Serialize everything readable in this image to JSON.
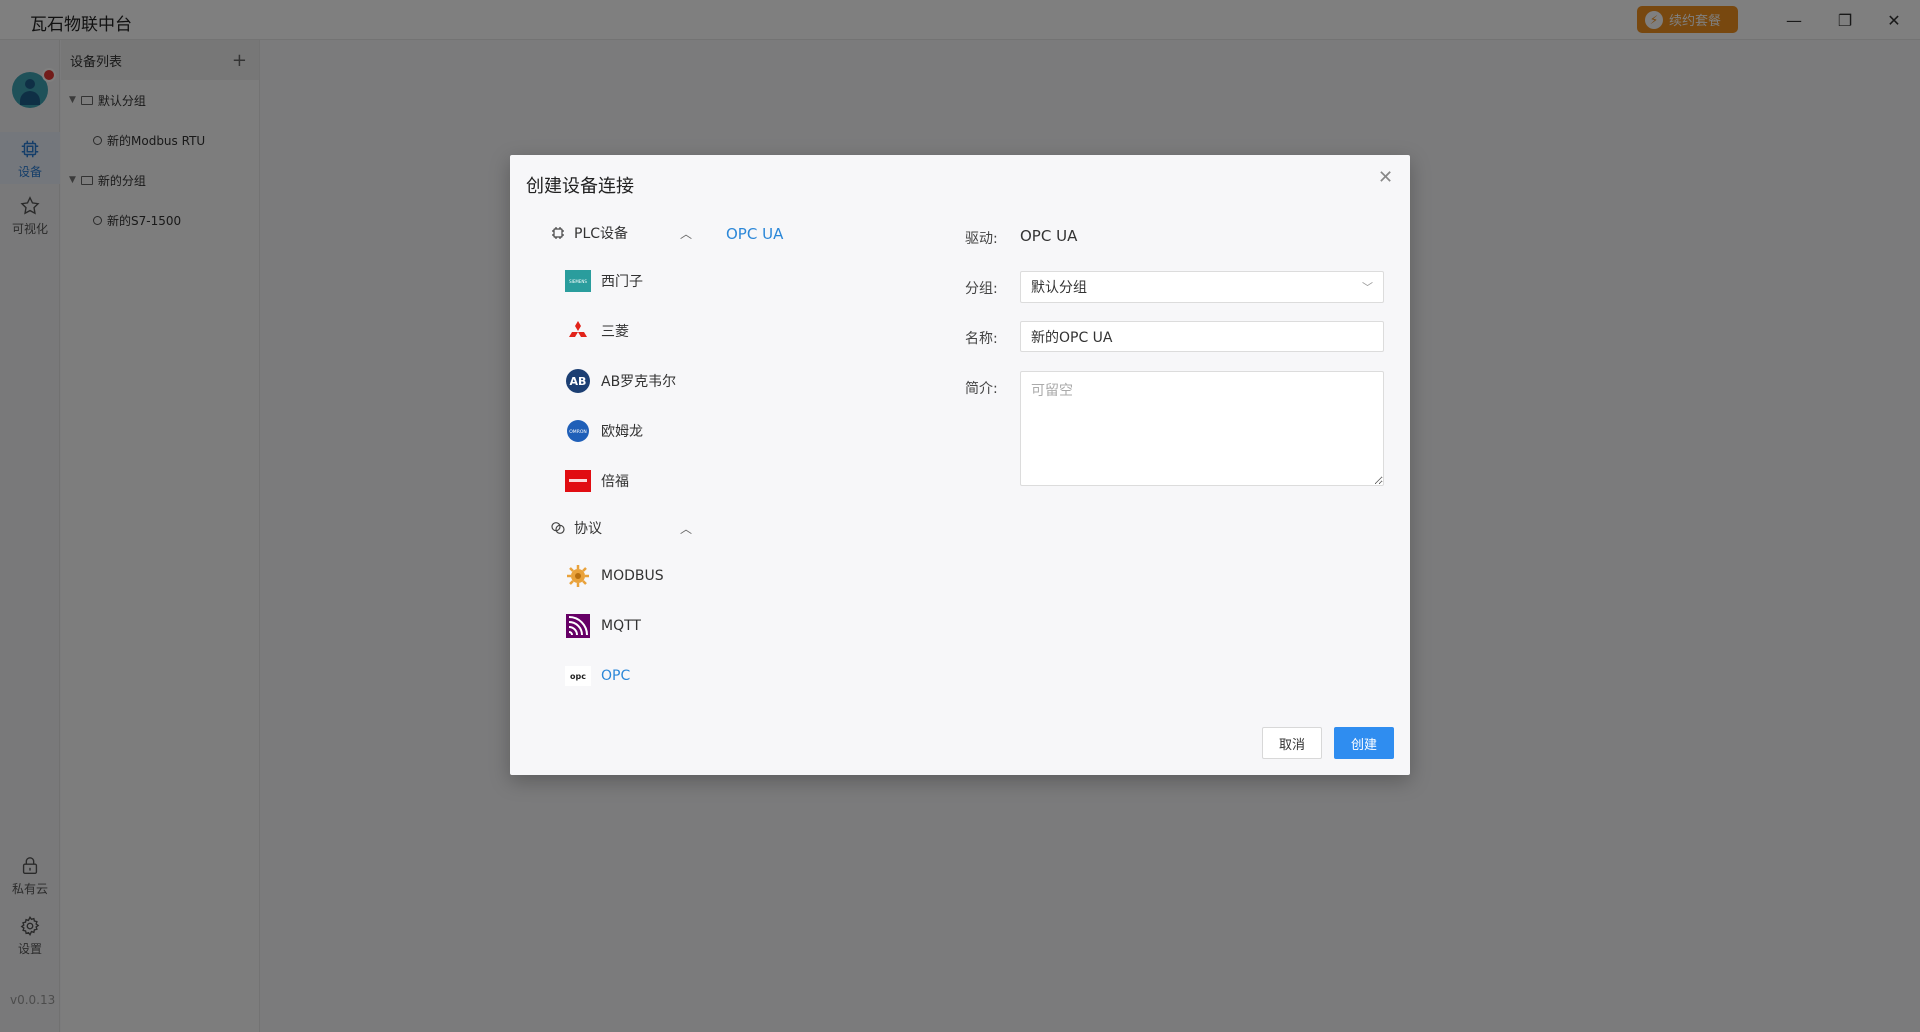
{
  "titlebar": {
    "app_title": "瓦石物联中台",
    "upgrade_label": "续约套餐"
  },
  "sidebar": {
    "items": [
      {
        "label": "设备",
        "icon": "chip-icon",
        "active": true
      },
      {
        "label": "可视化",
        "icon": "star-icon",
        "active": false
      }
    ],
    "bottom_items": [
      {
        "label": "私有云",
        "icon": "lock-icon"
      },
      {
        "label": "设置",
        "icon": "gear-icon"
      }
    ],
    "version": "v0.0.13"
  },
  "device_list": {
    "title": "设备列表",
    "groups": [
      {
        "name": "默认分组",
        "devices": [
          "新的Modbus RTU"
        ]
      },
      {
        "name": "新的分组",
        "devices": [
          "新的S7-1500"
        ]
      }
    ]
  },
  "dialog": {
    "title": "创建设备连接",
    "categories": [
      {
        "label": "PLC设备",
        "icon": "chip-icon",
        "brands": [
          {
            "label": "西门子",
            "icon": "siemens-logo-icon",
            "color": "#2a9d9d"
          },
          {
            "label": "三菱",
            "icon": "mitsubishi-logo-icon",
            "color": "#e2231a"
          },
          {
            "label": "AB罗克韦尔",
            "icon": "allen-bradley-logo-icon",
            "color": "#1c3f73"
          },
          {
            "label": "欧姆龙",
            "icon": "omron-logo-icon",
            "color": "#1f5fb8"
          },
          {
            "label": "倍福",
            "icon": "beckhoff-logo-icon",
            "color": "#e10d12"
          }
        ]
      },
      {
        "label": "协议",
        "icon": "link-icon",
        "brands": [
          {
            "label": "MODBUS",
            "icon": "modbus-logo-icon",
            "color": "#e9a23b"
          },
          {
            "label": "MQTT",
            "icon": "mqtt-logo-icon",
            "color": "#660066"
          },
          {
            "label": "OPC",
            "icon": "opc-logo-icon",
            "color": "#222222",
            "selected": true
          }
        ]
      }
    ],
    "model_options": [
      "OPC UA"
    ],
    "form": {
      "driver_label": "驱动:",
      "driver_value": "OPC UA",
      "group_label": "分组:",
      "group_value": "默认分组",
      "name_label": "名称:",
      "name_value": "新的OPC UA",
      "desc_label": "简介:",
      "desc_placeholder": "可留空"
    },
    "cancel_label": "取消",
    "create_label": "创建"
  },
  "colors": {
    "accent": "#2f8df0",
    "upgrade": "#f0901e"
  }
}
